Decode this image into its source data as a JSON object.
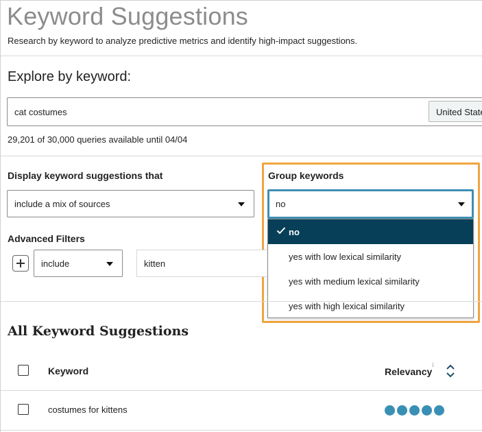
{
  "page": {
    "title": "Keyword Suggestions",
    "subtitle": "Research by keyword to analyze predictive metrics and identify high-impact suggestions."
  },
  "explore": {
    "heading": "Explore by keyword:",
    "keyword_value": "cat costumes",
    "country_label": "United States",
    "quota_text": "29,201 of 30,000 queries available until 04/04"
  },
  "display": {
    "label": "Display keyword suggestions that",
    "selected": "include a mix of sources"
  },
  "group": {
    "label": "Group keywords",
    "selected": "no",
    "options": [
      "no",
      "yes with low lexical similarity",
      "yes with medium lexical similarity",
      "yes with high lexical similarity"
    ],
    "highlight_color": "#f0a540",
    "selected_bg": "#083f58"
  },
  "advanced": {
    "label": "Advanced Filters",
    "add_icon": "plus-icon",
    "mode": "include",
    "term": "kitten"
  },
  "results": {
    "heading": "All Keyword Suggestions",
    "columns": {
      "keyword": "Keyword",
      "relevancy": "Relevancy",
      "info_glyph": "i"
    },
    "rows": [
      {
        "keyword": "costumes for kittens",
        "relevancy_dots": 5
      }
    ],
    "dot_color": "#3a8fb5"
  }
}
